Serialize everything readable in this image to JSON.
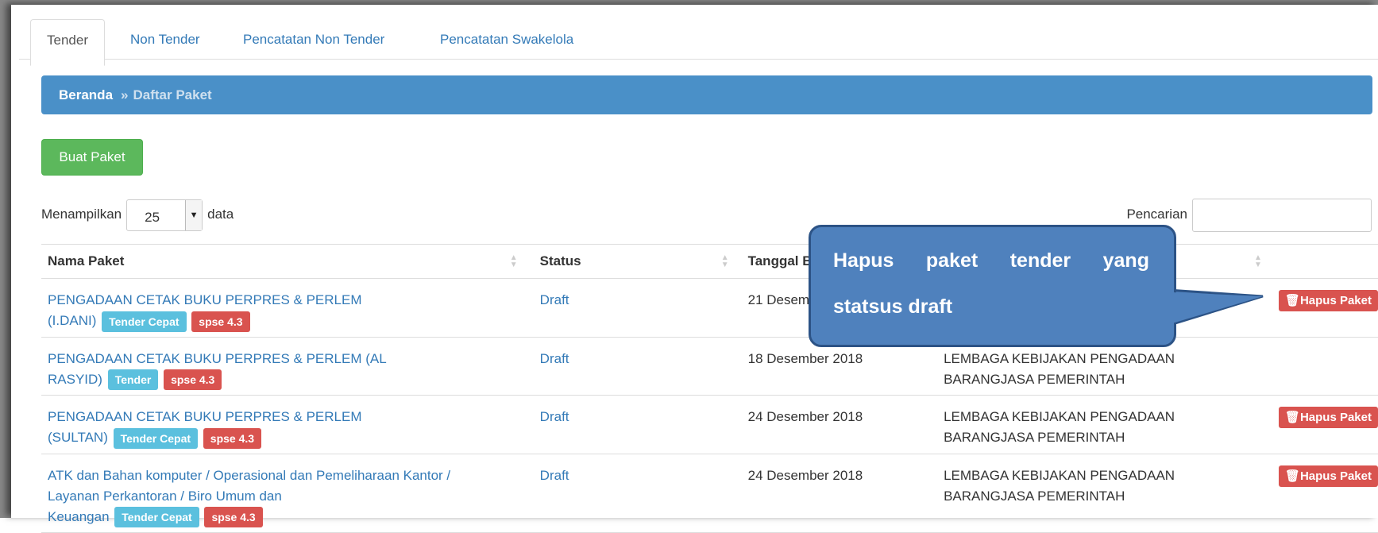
{
  "tabs": [
    {
      "label": "Tender",
      "active": true
    },
    {
      "label": "Non Tender",
      "active": false
    },
    {
      "label": "Pencatatan Non Tender",
      "active": false
    },
    {
      "label": "Pencatatan Swakelola",
      "active": false
    }
  ],
  "breadcrumb": {
    "home": "Beranda",
    "separator": "»",
    "current": "Daftar Paket"
  },
  "create_button": "Buat Paket",
  "length": {
    "prefix": "Menampilkan",
    "value": "25",
    "suffix": "data"
  },
  "search": {
    "label": "Pencarian",
    "value": ""
  },
  "table": {
    "headers": [
      "Nama Paket",
      "Status",
      "Tanggal B",
      "",
      ""
    ],
    "rows": [
      {
        "name_line1": "PENGADAAN CETAK BUKU PERPRES & PERLEM",
        "name_line2": "(I.DANI)",
        "type_label": "Tender Cepat",
        "version_label": "spse 4.3",
        "status": "Draft",
        "date": "21 Desember 2018",
        "agency_line1": "",
        "agency_line2": "",
        "delete_label": "Hapus Paket"
      },
      {
        "name_line1": "PENGADAAN CETAK BUKU PERPRES & PERLEM (AL",
        "name_line2": "RASYID)",
        "type_label": "Tender",
        "version_label": "spse 4.3",
        "status": "Draft",
        "date": "18 Desember 2018",
        "agency_line1": "LEMBAGA KEBIJAKAN PENGADAAN",
        "agency_line2": "BARANGJASA PEMERINTAH",
        "delete_label": ""
      },
      {
        "name_line1": "PENGADAAN CETAK BUKU PERPRES & PERLEM",
        "name_line2": "(SULTAN)",
        "type_label": "Tender Cepat",
        "version_label": "spse 4.3",
        "status": "Draft",
        "date": "24 Desember 2018",
        "agency_line1": "LEMBAGA KEBIJAKAN PENGADAAN",
        "agency_line2": "BARANGJASA PEMERINTAH",
        "delete_label": "Hapus Paket"
      },
      {
        "name_line1": "ATK dan Bahan komputer / Operasional dan Pemeliharaan Kantor /",
        "name_line2": "Layanan Perkantoran / Biro Umum dan",
        "name_line3": "Keuangan",
        "type_label": "Tender Cepat",
        "version_label": "spse 4.3",
        "status": "Draft",
        "date": "24 Desember 2018",
        "agency_line1": "LEMBAGA KEBIJAKAN PENGADAAN",
        "agency_line2": "BARANGJASA PEMERINTAH",
        "delete_label": "Hapus Paket"
      }
    ]
  },
  "callout": {
    "words": [
      "Hapus",
      "paket",
      "tender",
      "yang"
    ],
    "line2": "statsus draft"
  },
  "colors": {
    "breadcrumb": "#4a90c8",
    "create_button": "#5cb85c",
    "label_info": "#5bc0de",
    "label_danger": "#d9534f",
    "callout": "#4f81bd"
  },
  "icons": {
    "delete": "trash-icon",
    "sort": "sort-icon",
    "select_arrow": "caret-down-icon"
  }
}
